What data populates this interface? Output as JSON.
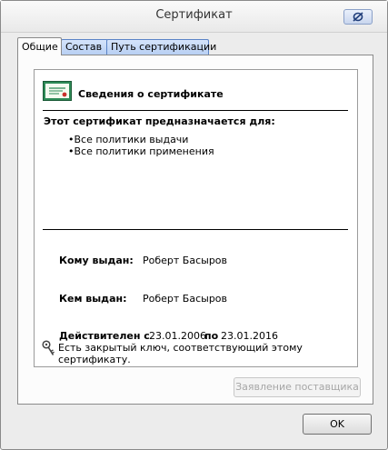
{
  "window": {
    "title": "Сертификат"
  },
  "tabs": [
    {
      "label": "Общие",
      "active": true
    },
    {
      "label": "Состав",
      "active": false
    },
    {
      "label": "Путь сертификации",
      "active": false
    }
  ],
  "general": {
    "info_title": "Сведения о сертификате",
    "purpose_heading": "Этот сертификат предназначается для:",
    "policies": [
      "•Все политики выдачи",
      "•Все политики применения"
    ],
    "issued_to_label": "Кому выдан:",
    "issued_to_value": "Роберт Басыров",
    "issued_by_label": "Кем выдан:",
    "issued_by_value": "Роберт Басыров",
    "valid_from_label": "Действителен с",
    "valid_from_value": "23.01.2006",
    "valid_to_label": "по",
    "valid_to_value": "23.01.2016",
    "private_key_text": "Есть закрытый ключ, соответствующий этому сертификату."
  },
  "buttons": {
    "issuer_statement": "Заявление поставщика",
    "ok": "OK"
  },
  "icons": {
    "certificate": "certificate-icon",
    "key": "key-icon",
    "close": "close-icon"
  },
  "colors": {
    "tab_accent": "#5b84c6",
    "certificate_green": "#2e8b57"
  }
}
